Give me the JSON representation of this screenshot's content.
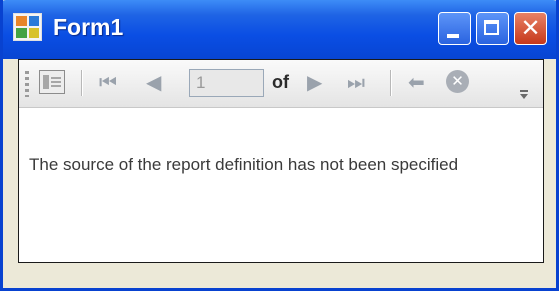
{
  "window": {
    "title": "Form1",
    "icon": "winforms-app-icon",
    "caption_buttons": [
      "minimize-icon",
      "maximize-icon",
      "close-icon"
    ]
  },
  "toolbar": {
    "items": [
      "document-map-icon",
      "first-page-icon",
      "previous-page-icon",
      "next-page-icon",
      "last-page-icon",
      "back-icon",
      "stop-icon",
      "overflow-icon"
    ],
    "page_number": "1",
    "of_label": "of"
  },
  "report": {
    "message": "The source of the report definition has not been specified"
  },
  "colors": {
    "titlebar": "#0a4ee4",
    "close_button": "#c6381b",
    "disabled_icon": "#9aa2ac"
  }
}
